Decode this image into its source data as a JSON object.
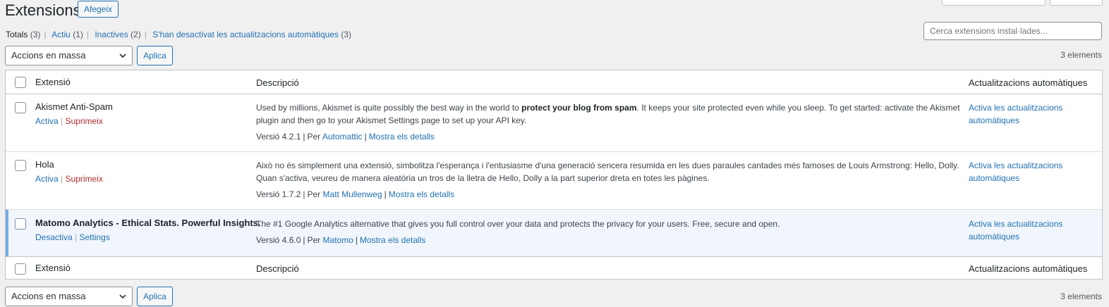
{
  "page": {
    "title": "Extensions",
    "add_button": "Afegeix"
  },
  "filters": [
    {
      "label": "Totals",
      "count": "(3)",
      "current": true
    },
    {
      "label": "Actiu",
      "count": "(1)",
      "current": false
    },
    {
      "label": "Inactives",
      "count": "(2)",
      "current": false
    },
    {
      "label": "S'han desactivat les actualitzacions automàtiques",
      "count": "(3)",
      "current": false
    }
  ],
  "search": {
    "placeholder": "Cerca extensions instal·lades..."
  },
  "bulk": {
    "select_value": "Accions en massa",
    "apply_label": "Aplica",
    "count_label": "3 elements"
  },
  "table": {
    "headers": {
      "name": "Extensió",
      "description": "Descripció",
      "auto_updates": "Actualitzacions automàtiques"
    },
    "plugins": [
      {
        "name": "Akismet Anti-Spam",
        "actions": [
          "Activa",
          "Suprimeix"
        ],
        "desc_before": "Used by millions, Akismet is quite possibly the best way in the world to ",
        "desc_strong": "protect your blog from spam",
        "desc_after": ". It keeps your site protected even while you sleep. To get started: activate the Akismet plugin and then go to your Akismet Settings page to set up your API key.",
        "version": "Versió 4.2.1",
        "by_label": "Per",
        "author": "Automattic",
        "details": "Mostra els detalls",
        "auto_link_1": "Activa les actualitzacions",
        "auto_link_2": "automàtiques"
      },
      {
        "name": "Hola",
        "actions": [
          "Activa",
          "Suprimeix"
        ],
        "desc": "Això no és simplement una extensió, simbolitza l'esperança i l'entusiasme d'una generació sencera resumida en les dues paraules cantades més famoses de Louis Armstrong: Hello, Dolly. Quan s'activa, veureu de manera aleatòria un tros de la lletra de Hello, Dolly a la part superior dreta en totes les pàgines.",
        "version": "Versió 1.7.2",
        "by_label": "Per",
        "author": "Matt Mullenweg",
        "details": "Mostra els detalls",
        "auto_link_1": "Activa les actualitzacions",
        "auto_link_2": "automàtiques"
      },
      {
        "name": "Matomo Analytics - Ethical Stats. Powerful Insights.",
        "actions": [
          "Desactiva",
          "Settings"
        ],
        "desc": "The #1 Google Analytics alternative that gives you full control over your data and protects the privacy for your users. Free, secure and open.",
        "version": "Versió 4.6.0",
        "by_label": "Per",
        "author": "Matomo",
        "details": "Mostra els detalls",
        "auto_link_1": "Activa les actualitzacions",
        "auto_link_2": "automàtiques"
      }
    ]
  }
}
